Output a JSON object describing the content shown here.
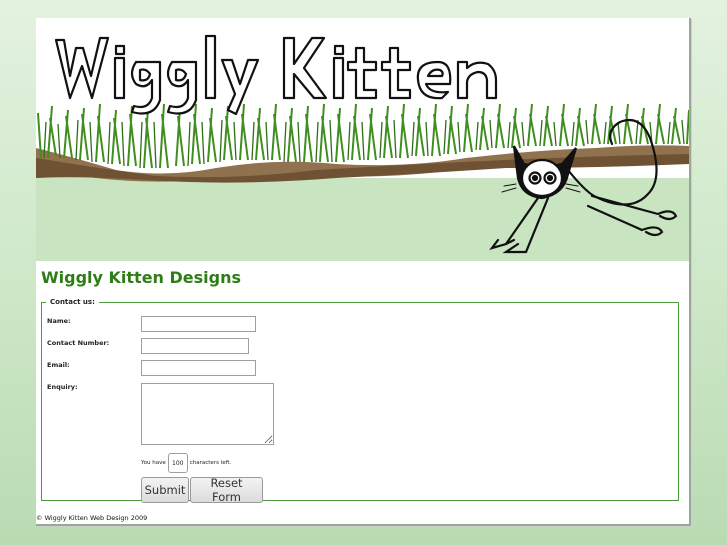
{
  "header": {
    "logo_text": "Wiggly Kitten"
  },
  "main": {
    "title": "Wiggly Kitten Designs"
  },
  "form": {
    "legend": "Contact us:",
    "fields": {
      "name": {
        "label": "Name:",
        "value": ""
      },
      "contact_number": {
        "label": "Contact Number:",
        "value": ""
      },
      "email": {
        "label": "Email:",
        "value": ""
      },
      "enquiry": {
        "label": "Enquiry:",
        "value": ""
      }
    },
    "counter": {
      "prefix": "You have",
      "value": "100",
      "suffix": "characters left."
    },
    "buttons": {
      "submit": "Submit",
      "reset": "Reset Form"
    }
  },
  "footer": {
    "text": "© Wiggly Kitten Web Design 2009"
  },
  "colors": {
    "title_green": "#2e7d16",
    "grass_green": "#3f8f1e",
    "soil_brown": "#8a6a45",
    "banner_band": "#c9e4c1",
    "fieldset_border": "#4d9a3c"
  }
}
